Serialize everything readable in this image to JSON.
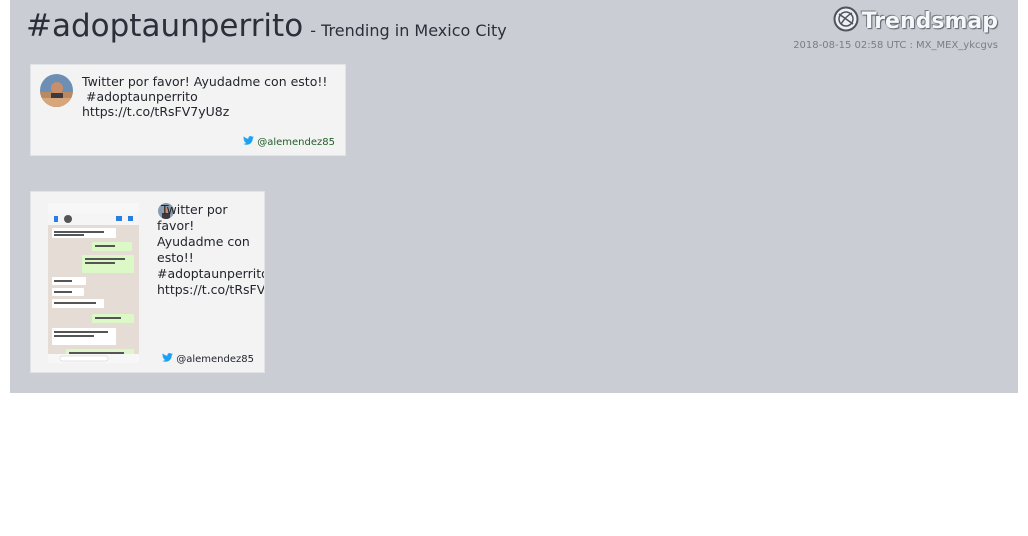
{
  "header": {
    "hashtag": "#adoptaunperrito",
    "subtitle": "- Trending in Mexico City",
    "logo_text": "Trendsmap",
    "meta": "2018-08-15 02:58 UTC : MX_MEX_ykcgvs"
  },
  "colors": {
    "panel_bg": "#cbcdd5",
    "card_bg": "#f3f3f4",
    "twitter_blue": "#1da1f2",
    "whatsapp_bubble": "#dcf8c6"
  },
  "tweets": [
    {
      "text": "Twitter por favor! Ayudadme con esto!!\n #adoptaunperrito\nhttps://t.co/tRsFV7yU8z",
      "user": "@alemendez85",
      "icon": "twitter-bird-icon"
    },
    {
      "text": " Twitter por\nfavor!\nAyudadme con\nesto!!\n#adoptaunperrito\nhttps://t.co/tRsFV",
      "user": "@alemendez85",
      "icon": "twitter-bird-icon",
      "media": {
        "status_left": "••ıl Inigo",
        "status_time": "15:48",
        "status_battery": "64 %",
        "contact": "PRINCE 👑",
        "messages": [
          {
            "side": "in",
            "text": "hostil, estatic de por rte quie nos meer el sofá 😂"
          },
          {
            "side": "out",
            "text": "Venga va"
          },
          {
            "side": "out",
            "text": "Cuantos RTs para que adoptemos uno?"
          },
          {
            "side": "in",
            "text": "Jajajaja"
          },
          {
            "side": "in",
            "text": "En serio?"
          },
          {
            "side": "in",
            "text": "Con tus 30 seguidores?"
          },
          {
            "side": "out",
            "text": "No te atreves..."
          },
          {
            "side": "in",
            "text": "Venga va, si consigues 1.000 tenemos perro 🐕 💪"
          },
          {
            "side": "out",
            "text": "Siiiiii No sabes lo que has hecho"
          }
        ]
      }
    }
  ]
}
